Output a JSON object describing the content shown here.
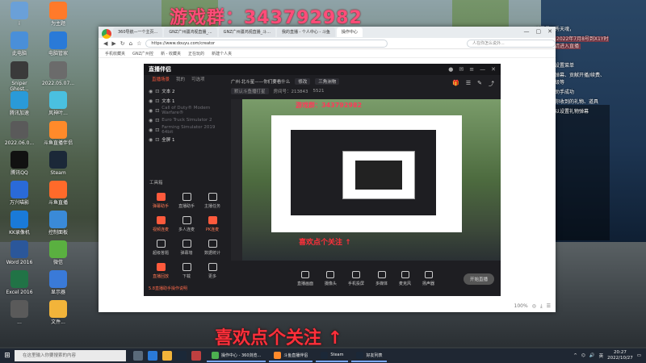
{
  "watermark": {
    "top": "游戏群：343792982",
    "bottom": "喜欢点个关注 ↑"
  },
  "desktop_icons": [
    {
      "label": "i",
      "color": "#6aa0d8"
    },
    {
      "label": "为主题",
      "color": "#ff7a2a"
    },
    {
      "label": "此电脑",
      "color": "#4a8fd8"
    },
    {
      "label": "电脑管家",
      "color": "#2a7ad8"
    },
    {
      "label": "Sniper Ghost...",
      "color": "#3a3a3a"
    },
    {
      "label": "2022.05.07...",
      "color": "#6b6b6b"
    },
    {
      "label": "腾讯加速",
      "color": "#2a9ad8"
    },
    {
      "label": "风神叶...",
      "color": "#4ac0e0"
    },
    {
      "label": "2022.06.0...",
      "color": "#5a5a5a"
    },
    {
      "label": "斗鱼直播伴侣",
      "color": "#ff8a2a"
    },
    {
      "label": "腾讯QQ",
      "color": "#111"
    },
    {
      "label": "Steam",
      "color": "#1b2838"
    },
    {
      "label": "万兴喵影",
      "color": "#2a6ad8"
    },
    {
      "label": "斗鱼直播",
      "color": "#ff6a2a"
    },
    {
      "label": "KK录像机",
      "color": "#1a7ad8"
    },
    {
      "label": "控制面板",
      "color": "#3a8ad8"
    },
    {
      "label": "Word 2016",
      "color": "#2b579a"
    },
    {
      "label": "微信",
      "color": "#5ab040"
    },
    {
      "label": "Excel 2016",
      "color": "#217346"
    },
    {
      "label": "显示器",
      "color": "#3a7ad8"
    },
    {
      "label": "...",
      "color": "#5a5a5a"
    },
    {
      "label": "文件...",
      "color": "#f2b43a"
    }
  ],
  "browser": {
    "tabs": [
      "360导航—一个主页...",
      "GNZ广州疆鸿视直播_...",
      "GNZ广州疆鸿视直播_斗...",
      "我的直播 - 个人中心 - 斗鱼",
      "操作中心"
    ],
    "url": "https://www.douyu.com/creator",
    "search_placeholder": "人在你怎么说外...",
    "bookmarks": [
      "手机收藏夹",
      "GNZ广州控",
      "新 - 收藏夹",
      "正在玩的",
      "新建个人夹"
    ],
    "status": [
      "100%",
      "◎",
      "⤓",
      "☰"
    ]
  },
  "app": {
    "title": "直播伴侣",
    "tabs": [
      "直播场景",
      "我的",
      "可选项"
    ],
    "scenes": [
      {
        "name": "文本 2",
        "dim": false
      },
      {
        "name": "文本 1",
        "dim": false
      },
      {
        "name": "Call of Duty® Modern Warfare®",
        "dim": true
      },
      {
        "name": "Euro Truck Simulator 2",
        "dim": true
      },
      {
        "name": "Farming Simulator 2019 64bit",
        "dim": true
      },
      {
        "name": "全屏 1",
        "dim": false
      }
    ],
    "tools_title": "工具箱",
    "tools": [
      {
        "label": "弹幕助手",
        "hot": true
      },
      {
        "label": "直播助手",
        "hot": false
      },
      {
        "label": "主播任务",
        "hot": false
      },
      {
        "label": "视频连麦",
        "hot": true
      },
      {
        "label": "多人连麦",
        "hot": false
      },
      {
        "label": "PK连麦",
        "hot": true
      },
      {
        "label": "超级答题",
        "hot": false
      },
      {
        "label": "弹幕墙",
        "hot": false
      },
      {
        "label": "数据统计",
        "hot": false
      },
      {
        "label": "直播回放",
        "hot": true
      },
      {
        "label": "下载",
        "hot": false
      },
      {
        "label": "更多",
        "hot": false
      }
    ],
    "footer": "5.8直播助手操作说明",
    "live_info": {
      "title": "广州·北斗星——你们要看什么",
      "edit": "修改",
      "category": "三角洲物",
      "room": "默认斗鱼播打星",
      "room_id": "房间号：213843",
      "viewers": "5521"
    },
    "controls": [
      "直播画面",
      "摄像头",
      "手机投屏",
      "多媒体",
      "麦克风",
      "扬声器"
    ],
    "start_button": "开始直播"
  },
  "chat": [
    {
      "text": "这里是天秀天魂，",
      "hl": false
    },
    {
      "text": "用户名：2022年7月8号到X1Y时期的主播请进入直播",
      "hl": true
    },
    {
      "text": "弹幕",
      "hl": false
    },
    {
      "text": "右上角有设置菜单",
      "hl": false
    },
    {
      "text": "这里显示弹幕、贡献开播/续费、粉丝牌升级等",
      "hl": false
    },
    {
      "text": "添加弹幕助手成功",
      "hl": false
    },
    {
      "text": "这里显示你收到的礼物、道具",
      "hl": false
    },
    {
      "text": "点这里可以设置礼物弹幕",
      "hl": false
    }
  ],
  "taskbar": {
    "search_placeholder": "在这里输入你要搜索的内容",
    "tasks": [
      {
        "label": "操作中心 - 360浏览...",
        "color": "#4caf50"
      },
      {
        "label": "斗鱼直播伴侣",
        "color": "#ff8a2a"
      },
      {
        "label": "Steam",
        "color": "#1b2838"
      },
      {
        "label": "好友列表",
        "color": "#1b2838"
      }
    ],
    "time": "20:27",
    "date": "2022/10/27"
  }
}
